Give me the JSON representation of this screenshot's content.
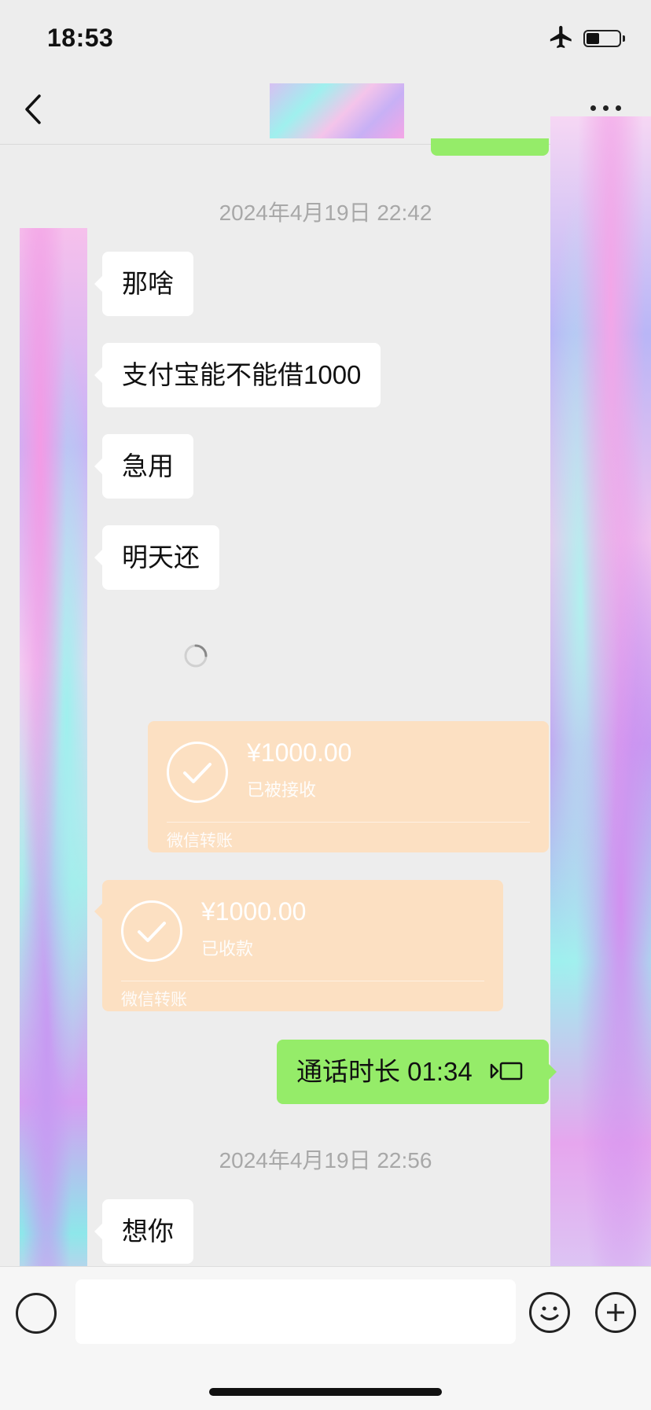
{
  "status_bar": {
    "time": "18:53",
    "airplane_icon": "airplane-icon",
    "battery_icon": "battery-icon"
  },
  "nav": {
    "back_icon": "chevron-left-icon",
    "more_icon": "more-horizontal-icon"
  },
  "messages": {
    "timestamp_1": "2024年4月19日 22:42",
    "m1": "那啥",
    "m2": "支付宝能不能借1000",
    "m3": "急用",
    "m4": "明天还",
    "transfer_sent": {
      "amount": "¥1000.00",
      "status": "已被接收",
      "footer": "微信转账"
    },
    "transfer_received": {
      "amount": "¥1000.00",
      "status": "已收款",
      "footer": "微信转账"
    },
    "call": {
      "label": "通话时长 01:34",
      "icon": "voice-call-icon"
    },
    "timestamp_2": "2024年4月19日 22:56",
    "m5": "想你"
  },
  "input_bar": {
    "voice_icon": "voice-icon",
    "emoji_icon": "emoji-icon",
    "plus_icon": "plus-icon"
  },
  "colors": {
    "background": "#ededed",
    "bubble_green": "#95ec69",
    "transfer_card": "#fce0c2",
    "timestamp_gray": "#a8a8a8"
  }
}
